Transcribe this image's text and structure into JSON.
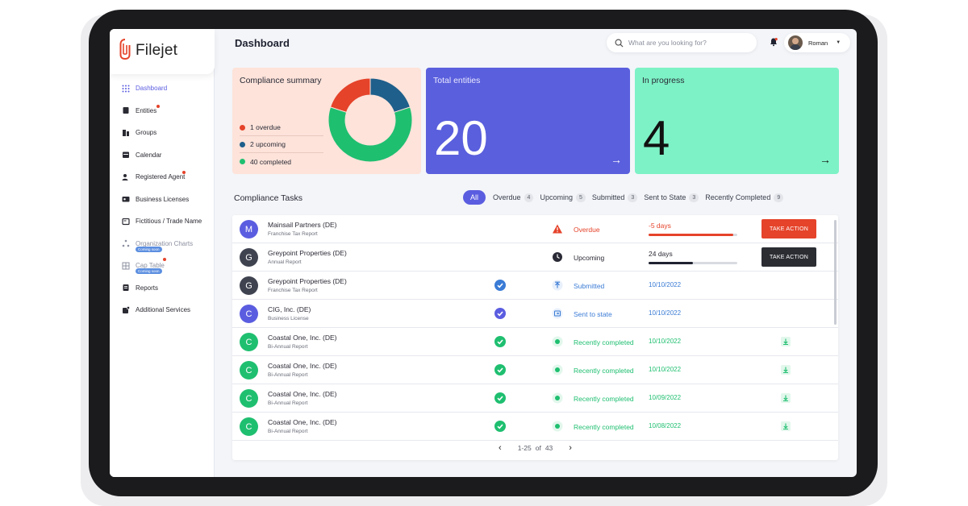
{
  "app": {
    "logo_text": "Filejet"
  },
  "header": {
    "title": "Dashboard",
    "search_placeholder": "What are you looking for?",
    "user_name": "Roman"
  },
  "sidebar": {
    "items": [
      {
        "label": "Dashboard",
        "icon": "grid-icon",
        "active": true
      },
      {
        "label": "Entities",
        "icon": "entities-icon",
        "badge": true
      },
      {
        "label": "Groups",
        "icon": "groups-icon"
      },
      {
        "label": "Calendar",
        "icon": "calendar-icon"
      },
      {
        "label": "Registered Agent",
        "icon": "agent-icon",
        "badge": true
      },
      {
        "label": "Business Licenses",
        "icon": "license-icon"
      },
      {
        "label": "Fictitious / Trade Name",
        "icon": "trade-name-icon"
      },
      {
        "label": "Organization Charts",
        "icon": "org-chart-icon",
        "soon": "Coming soon",
        "muted": true
      },
      {
        "label": "Cap Table",
        "icon": "cap-table-icon",
        "soon": "Coming soon",
        "muted": true,
        "badge": true
      },
      {
        "label": "Reports",
        "icon": "reports-icon"
      },
      {
        "label": "Additional Services",
        "icon": "services-icon"
      }
    ]
  },
  "compliance_summary": {
    "title": "Compliance summary",
    "legend": [
      {
        "label": "1 overdue",
        "color": "#e5432a"
      },
      {
        "label": "2 upcoming",
        "color": "#1f5f8b"
      },
      {
        "label": "40 completed",
        "color": "#1fbf70"
      }
    ],
    "donut_share": {
      "overdue": 0.2,
      "upcoming": 0.2,
      "completed": 0.6
    }
  },
  "total_entities": {
    "title": "Total entities",
    "value": "20",
    "arrow": "→"
  },
  "in_progress": {
    "title": "In progress",
    "value": "4",
    "arrow": "→"
  },
  "tasks": {
    "title": "Compliance Tasks",
    "filters": [
      {
        "label": "All",
        "count": ""
      },
      {
        "label": "Overdue",
        "count": "4"
      },
      {
        "label": "Upcoming",
        "count": "5"
      },
      {
        "label": "Submitted",
        "count": "3"
      },
      {
        "label": "Sent to State",
        "count": "3"
      },
      {
        "label": "Recently Completed",
        "count": "9"
      }
    ],
    "rows": [
      {
        "letter": "M",
        "name": "Mainsail Partners (DE)",
        "sub": "Franchise Tax Report",
        "avatar_color": "#5b5de0",
        "status": "Overdue",
        "status_color": "#e5432a",
        "days": "-5 days",
        "progress": 0.95,
        "bar_color": "#e5432a",
        "action": "TAKE ACTION",
        "action_color": "#e5432a"
      },
      {
        "letter": "G",
        "name": "Greypoint Properties (DE)",
        "sub": "Annual Report",
        "avatar_color": "#3f4350",
        "status": "Upcoming",
        "status_color": "#2a2a36",
        "days": "24 days",
        "progress": 0.5,
        "bar_color": "#1f2230",
        "action": "TAKE ACTION",
        "action_color": "#2b2d33"
      },
      {
        "letter": "G",
        "name": "Greypoint Properties (DE)",
        "sub": "Franchise Tax Report",
        "avatar_color": "#3f4350",
        "status": "Submitted",
        "status_color": "#3a7bd5",
        "date": "10/10/2022",
        "check_color": "#3a7bd5"
      },
      {
        "letter": "C",
        "name": "CIG, Inc. (DE)",
        "sub": "Business License",
        "avatar_color": "#5b5de0",
        "status": "Sent to state",
        "status_color": "#3a7bd5",
        "date": "10/10/2022",
        "check_color": "#5b5de0"
      },
      {
        "letter": "C",
        "name": "Coastal One, Inc. (DE)",
        "sub": "Bi-Annual Report",
        "avatar_color": "#1fbf70",
        "status": "Recently completed",
        "status_color": "#1fbf70",
        "date": "10/10/2022",
        "check_color": "#1fbf70",
        "download": true
      },
      {
        "letter": "C",
        "name": "Coastal One, Inc. (DE)",
        "sub": "Bi-Annual Report",
        "avatar_color": "#1fbf70",
        "status": "Recently completed",
        "status_color": "#1fbf70",
        "date": "10/10/2022",
        "check_color": "#1fbf70",
        "download": true
      },
      {
        "letter": "C",
        "name": "Coastal One, Inc. (DE)",
        "sub": "Bi-Annual Report",
        "avatar_color": "#1fbf70",
        "status": "Recently completed",
        "status_color": "#1fbf70",
        "date": "10/09/2022",
        "check_color": "#1fbf70",
        "download": true
      },
      {
        "letter": "C",
        "name": "Coastal One, Inc. (DE)",
        "sub": "Bi-Annual Report",
        "avatar_color": "#1fbf70",
        "status": "Recently completed",
        "status_color": "#1fbf70",
        "date": "10/08/2022",
        "check_color": "#1fbf70",
        "download": true
      }
    ],
    "pagination": {
      "range": "1-25",
      "of": "of",
      "total": "43",
      "prev": "‹",
      "next": "›"
    }
  }
}
